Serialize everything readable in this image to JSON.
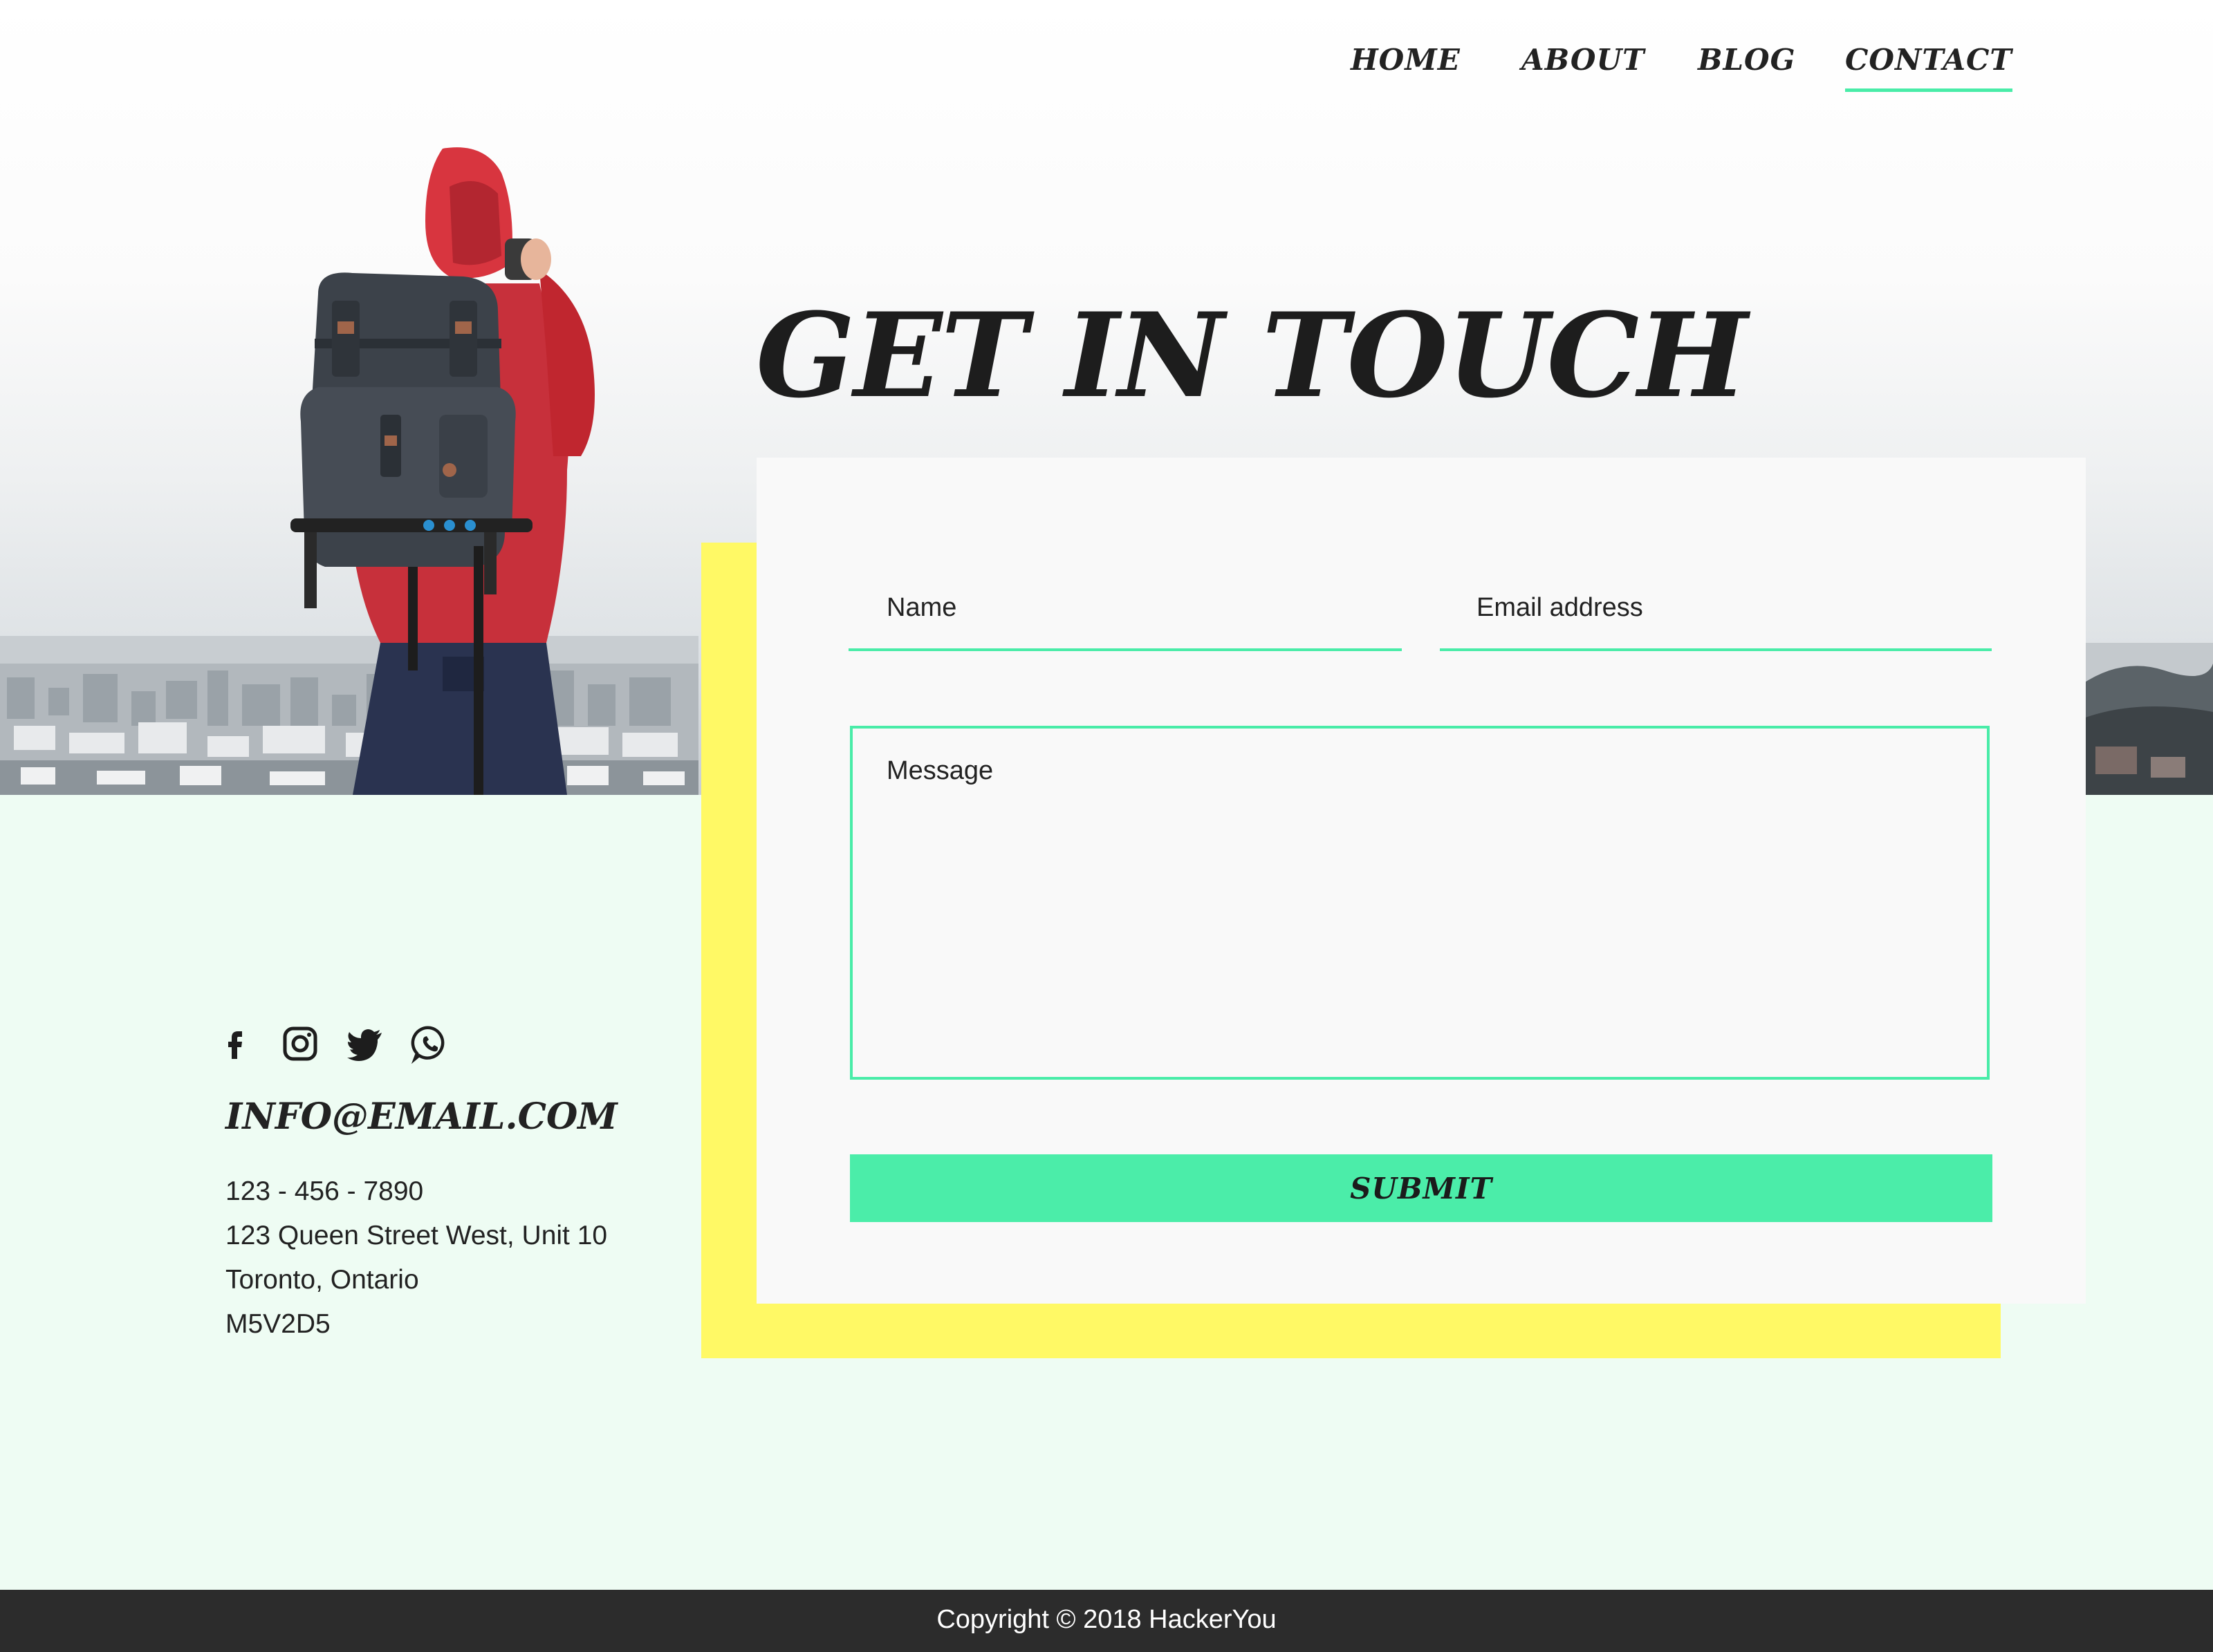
{
  "nav": {
    "items": [
      {
        "label": "HOME",
        "active": false
      },
      {
        "label": "ABOUT",
        "active": false
      },
      {
        "label": "BLOG",
        "active": false
      },
      {
        "label": "CONTACT",
        "active": true
      }
    ],
    "accent": "#49eca8"
  },
  "hero": {
    "title": "GET IN TOUCH"
  },
  "form": {
    "name_placeholder": "Name",
    "email_placeholder": "Email address",
    "message_placeholder": "Message",
    "submit_label": "SUBMIT",
    "accent": "#49eca8",
    "frame_color": "#fff965"
  },
  "contact": {
    "social_icons": [
      "facebook-icon",
      "instagram-icon",
      "twitter-icon",
      "whatsapp-icon"
    ],
    "email": "INFO@EMAIL.COM",
    "phone": "123 - 456 - 7890",
    "address_line1": "123 Queen Street West, Unit 10",
    "address_line2": "Toronto, Ontario",
    "postal_code": "M5V2D5"
  },
  "footer": {
    "copyright": "Copyright © 2018 HackerYou"
  }
}
